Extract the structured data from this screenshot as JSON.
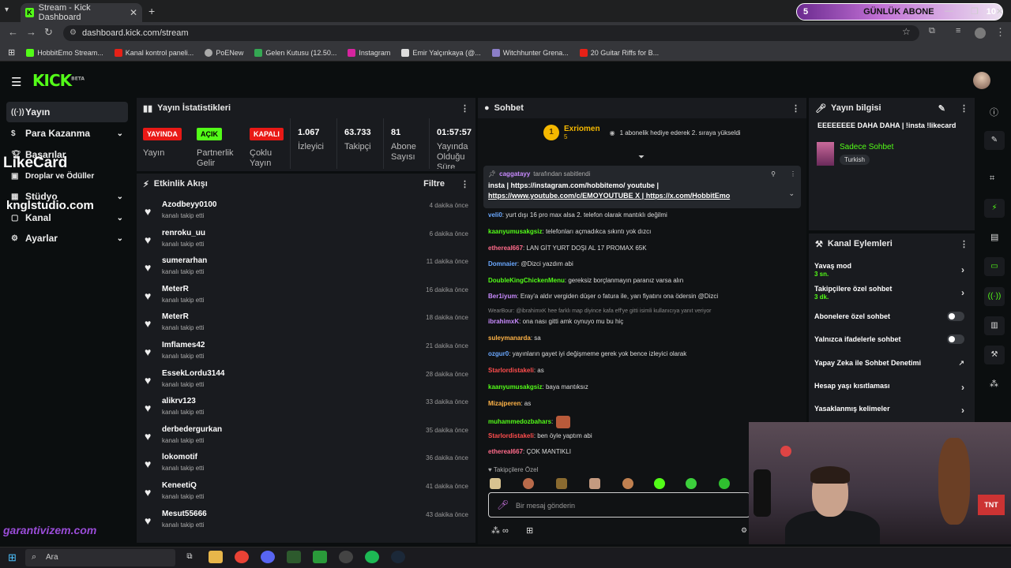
{
  "browser": {
    "tab_title": "Stream - Kick Dashboard",
    "url": "dashboard.kick.com/stream",
    "promo_count": "5",
    "promo_text": "GÜNLÜK ABONE",
    "promo_right": "10",
    "bookmarks": [
      "HobbitEmo Stream...",
      "Kanal kontrol paneli...",
      "PoENew",
      "Gelen Kutusu (12.50...",
      "Instagram",
      "Emir Yalçınkaya (@...",
      "Witchhunter Grena...",
      "20 Guitar Riffs for B..."
    ]
  },
  "header": {
    "logo": "KICK",
    "logo_tag": "BETA"
  },
  "sidebar": {
    "items": [
      {
        "label": "Yayın",
        "icon": "broadcast-icon"
      },
      {
        "label": "Para Kazanma",
        "icon": "money-icon"
      },
      {
        "label": "Başarılar",
        "icon": "trophy-icon"
      },
      {
        "label": "Droplar ve Ödüller",
        "icon": "gift-icon"
      },
      {
        "label": "Stüdyo",
        "icon": "studio-icon"
      },
      {
        "label": "Kanal",
        "icon": "channel-icon"
      },
      {
        "label": "Ayarlar",
        "icon": "gear-icon"
      }
    ],
    "overlay_likecard": "LikeCard",
    "overlay_kngl": "knglstudio.com",
    "overlay_garanti": "garantivizem.com"
  },
  "stats": {
    "title": "Yayın İstatistikleri",
    "badges": [
      {
        "badge": "YAYINDA",
        "label": "Yayın",
        "color": "#e91916"
      },
      {
        "badge": "AÇIK",
        "label": "Partnerlik Gelir",
        "color": "#53fc18"
      },
      {
        "badge": "KAPALI",
        "label": "Çoklu Yayın",
        "color": "#e91916"
      }
    ],
    "viewers": {
      "value": "1.067",
      "label": "İzleyici"
    },
    "followers": {
      "value": "63.733",
      "label": "Takipçi"
    },
    "subs": {
      "value": "81",
      "label": "Abone Sayısı"
    },
    "uptime": {
      "value": "01:57:57",
      "label": "Yayında Olduğu Süre"
    }
  },
  "events": {
    "title": "Etkinlik Akışı",
    "filter": "Filtre",
    "action": "kanalı takip etti",
    "items": [
      {
        "user": "Azodbeyy0100",
        "time": "4 dakika önce"
      },
      {
        "user": "renroku_uu",
        "time": "6 dakika önce"
      },
      {
        "user": "sumerarhan",
        "time": "11 dakika önce"
      },
      {
        "user": "MeterR",
        "time": "16 dakika önce"
      },
      {
        "user": "MeterR",
        "time": "18 dakika önce"
      },
      {
        "user": "Imflames42",
        "time": "21 dakika önce"
      },
      {
        "user": "EssekLordu3144",
        "time": "28 dakika önce"
      },
      {
        "user": "alikrv123",
        "time": "33 dakika önce"
      },
      {
        "user": "derbedergurkan",
        "time": "35 dakika önce"
      },
      {
        "user": "lokomotif",
        "time": "36 dakika önce"
      },
      {
        "user": "KeneetiQ",
        "time": "41 dakika önce"
      },
      {
        "user": "Mesut55666",
        "time": "43 dakika önce"
      }
    ]
  },
  "chat": {
    "title": "Sohbet",
    "gifter_name": "Exriomen",
    "gifter_count": "5",
    "gifter_rank": "1",
    "gifter_text": "1 abonelik hediye ederek 2. sıraya yükseldi",
    "pinned_by": "caggatayy",
    "pinned_suffix": "tarafından sabitlendi",
    "pinned_line1": "insta | https://instagram.com/hobbitemo/ youtube |",
    "pinned_line2": "https://www.youtube.com/c/EMOYOUTUBE X | https://x.com/HobbitEmo",
    "messages": [
      {
        "user": "veli0",
        "text": "yurt dışı 16 pro max alsa 2. telefon olarak mantıklı değilmi",
        "color": "#6aa8ff"
      },
      {
        "user": "kaanyumusakgsiz",
        "text": "telefonları açmadıkca sıkıntı yok dızcı",
        "color": "#53fc18"
      },
      {
        "user": "ethereal667",
        "text": "LAN GİT YURT DOŞI AL 17 PROMAX 65K",
        "color": "#ff6b8a"
      },
      {
        "user": "Domnaier",
        "text": "@Dizci yazdım abi",
        "color": "#6aa8ff"
      },
      {
        "user": "DoubleKingChickenMenu",
        "text": "gereksiz borçlanmayın paranız varsa alın",
        "color": "#53fc18"
      },
      {
        "user": "Ber1iyum",
        "text": "Eray'a aldır vergiden düşer o fatura ile, yarı fiyatını ona ödersin @Dizci",
        "color": "#c98bff"
      },
      {
        "user": "ibrahimxK",
        "text": "ona nası gitti amk oynuyo mu bu hiç",
        "color": "#c98bff",
        "reply": "WearBour: @ibrahimxK hee farklı map diyince kafa eff'ye gitti isimli kullanıcıya yanıt veriyor"
      },
      {
        "user": "suleymanarda",
        "text": "sa",
        "color": "#ffb347"
      },
      {
        "user": "ozgur0",
        "text": "yayınların gayet iyi değişmeme gerek yok bence izleyici olarak",
        "color": "#6aa8ff"
      },
      {
        "user": "Starlordistakeli",
        "text": "as",
        "color": "#ff4d4d"
      },
      {
        "user": "kaanyumusakgsiz",
        "text": "baya mantıksız",
        "color": "#53fc18"
      },
      {
        "user": "Mizajperen",
        "text": "as",
        "color": "#ffb347"
      },
      {
        "user": "muhammedozbahars",
        "text": "",
        "color": "#53fc18"
      },
      {
        "user": "Starlordistakeli",
        "text": "ben öyle yaptım abi",
        "color": "#ff4d4d"
      },
      {
        "user": "ethereal667",
        "text": "ÇOK MANTIKLI",
        "color": "#ff6b8a"
      }
    ],
    "followers_only": "Takipçilere Özel",
    "input_placeholder": "Bir mesaj gönderin"
  },
  "info": {
    "title": "Yayın bilgisi",
    "stream_title": "EEEEEEEE DAHA DAHA | !insta !likecard",
    "category": "Sadece Sohbet",
    "language": "Turkish"
  },
  "actions": {
    "title": "Kanal Eylemleri",
    "rows": [
      {
        "label": "Yavaş mod",
        "sub": "3 sn.",
        "kind": "chevron"
      },
      {
        "label": "Takipçilere özel sohbet",
        "sub": "3 dk.",
        "kind": "chevron"
      },
      {
        "label": "Abonelere özel sohbet",
        "sub": "",
        "kind": "toggle"
      },
      {
        "label": "Yalnızca ifadelerle sohbet",
        "sub": "",
        "kind": "toggle"
      },
      {
        "label": "Yapay Zeka ile Sohbet Denetimi",
        "sub": "",
        "kind": "external"
      },
      {
        "label": "Hesap yaşı kısıtlaması",
        "sub": "",
        "kind": "chevron"
      },
      {
        "label": "Yasaklanmış kelimeler",
        "sub": "",
        "kind": "chevron"
      }
    ]
  },
  "taskbar": {
    "search_placeholder": "Ara"
  }
}
